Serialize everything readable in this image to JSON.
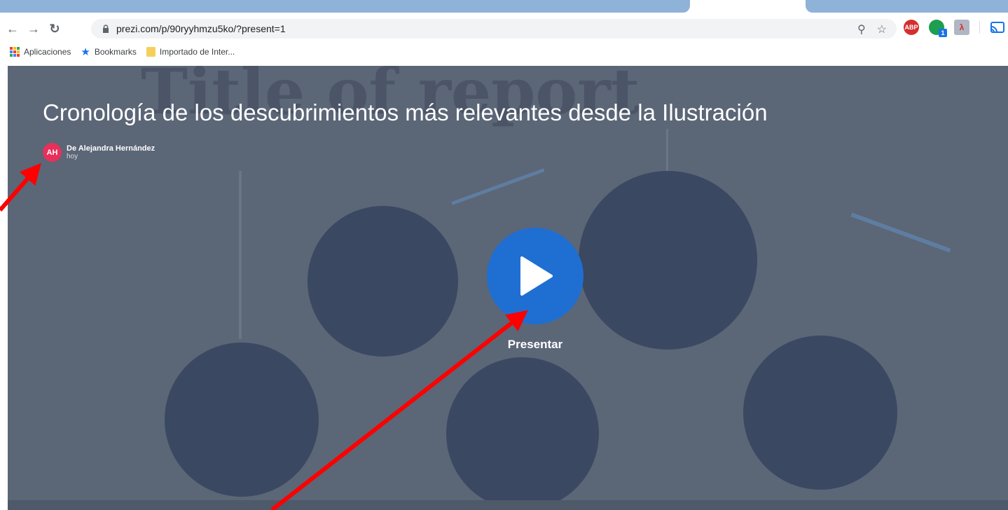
{
  "browser": {
    "url": "prezi.com/p/90ryyhmzu5ko/?present=1",
    "bookmarks": [
      {
        "label": "Aplicaciones",
        "icon": "apps-grid-icon"
      },
      {
        "label": "Bookmarks",
        "icon": "star-icon"
      },
      {
        "label": "Importado de Inter...",
        "icon": "folder-icon"
      }
    ],
    "extensions": {
      "abp_label": "ABP",
      "badge_count": "1"
    }
  },
  "presentation": {
    "background_title": "Title of report",
    "title": "Cronología de los descubrimientos más relevantes desde la Ilustración",
    "author": {
      "initials": "AH",
      "name": "De Alejandra Hernández",
      "date": "hoy"
    },
    "present_label": "Presentar"
  },
  "colors": {
    "play_button": "#1f6fd3",
    "avatar": "#e8305a",
    "annotation_arrow": "#ff0000"
  }
}
